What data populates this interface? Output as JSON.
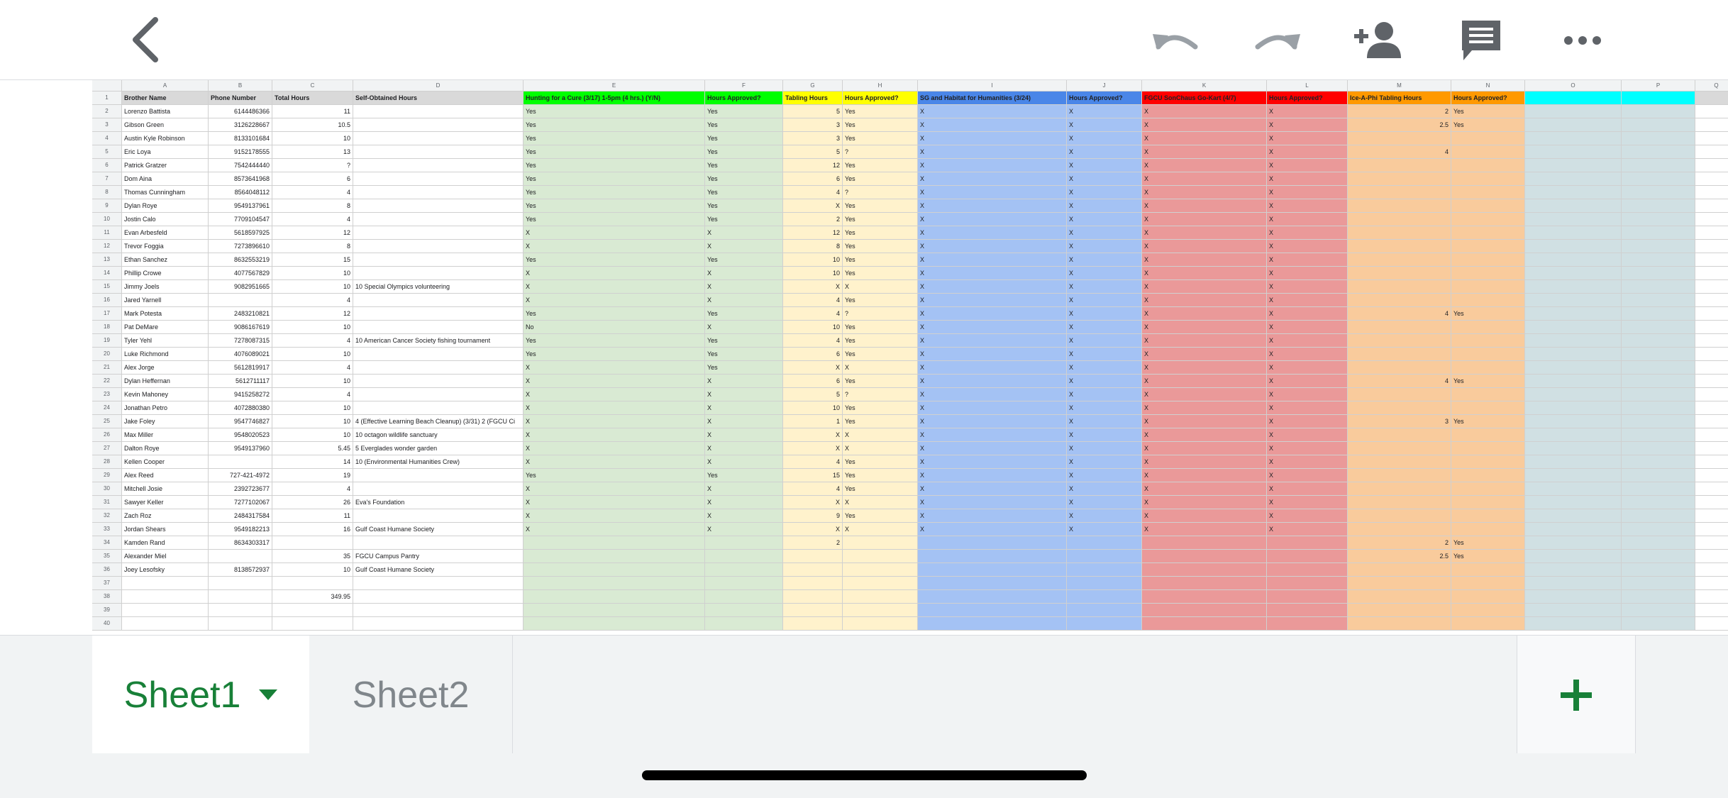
{
  "toolbar": {
    "back_icon": "back-chevron-icon",
    "undo_icon": "undo-icon",
    "redo_icon": "redo-icon",
    "share_icon": "add-person-icon",
    "comment_icon": "comment-icon",
    "more_icon": "more-horizontal-icon"
  },
  "sheet": {
    "columns": [
      "A",
      "B",
      "C",
      "D",
      "E",
      "F",
      "G",
      "H",
      "I",
      "J",
      "K",
      "L",
      "M",
      "N",
      "O",
      "P",
      "Q"
    ],
    "column_colors": {
      "E": "#d9ead3",
      "F": "#d9ead3",
      "G": "#fff2cc",
      "H": "#fff2cc",
      "I": "#a4c2f4",
      "J": "#a4c2f4",
      "K": "#ea9999",
      "L": "#ea9999",
      "M": "#f9cb9c",
      "N": "#f9cb9c",
      "O": "#d0e0e3",
      "P": "#d0e0e3"
    },
    "header_colors": {
      "E": "#00ff00",
      "F": "#00ff00",
      "G": "#ffff00",
      "H": "#ffff00",
      "I": "#4a86e8",
      "J": "#4a86e8",
      "K": "#ff0000",
      "L": "#ff0000",
      "M": "#ff9900",
      "N": "#ff9900",
      "O": "#00ffff",
      "P": "#00ffff"
    },
    "headers": [
      "Brother Name",
      "Phone Number",
      "Total Hours",
      "Self-Obtained Hours",
      "Hunting for a Cure (3/17) 1-5pm (4 hrs.) (Y/N)",
      "Hours Approved?",
      "Tabling Hours",
      "Hours Approved?",
      "SG and Habitat for Humanities (3/24)",
      "Hours Approved?",
      "FGCU SonChaus Go-Kart (4/7)",
      "Hours Approved?",
      "Ice-A-Phi Tabling Hours",
      "Hours Approved?",
      "",
      "",
      ""
    ],
    "rows": [
      [
        "Lorenzo Battista",
        "6144486366",
        "11",
        "",
        "Yes",
        "Yes",
        "5",
        "Yes",
        "X",
        "X",
        "X",
        "X",
        "2",
        "Yes",
        "",
        "",
        ""
      ],
      [
        "Gibson Green",
        "3126228667",
        "10.5",
        "",
        "Yes",
        "Yes",
        "3",
        "Yes",
        "X",
        "X",
        "X",
        "X",
        "2.5",
        "Yes",
        "",
        "",
        ""
      ],
      [
        "Austin Kyle Robinson",
        "8133101684",
        "10",
        "",
        "Yes",
        "Yes",
        "3",
        "Yes",
        "X",
        "X",
        "X",
        "X",
        "",
        "",
        "",
        "",
        ""
      ],
      [
        "Eric Loya",
        "9152178555",
        "13",
        "",
        "Yes",
        "Yes",
        "5",
        "?",
        "X",
        "X",
        "X",
        "X",
        "4",
        "",
        "",
        "",
        ""
      ],
      [
        "Patrick Gratzer",
        "7542444440",
        "?",
        "",
        "Yes",
        "Yes",
        "12",
        "Yes",
        "X",
        "X",
        "X",
        "X",
        "",
        "",
        "",
        "",
        ""
      ],
      [
        "Dom Aina",
        "8573641968",
        "6",
        "",
        "Yes",
        "Yes",
        "6",
        "Yes",
        "X",
        "X",
        "X",
        "X",
        "",
        "",
        "",
        "",
        ""
      ],
      [
        "Thomas Cunningham",
        "8564048112",
        "4",
        "",
        "Yes",
        "Yes",
        "4",
        "?",
        "X",
        "X",
        "X",
        "X",
        "",
        "",
        "",
        "",
        ""
      ],
      [
        "Dylan Roye",
        "9549137961",
        "8",
        "",
        "Yes",
        "Yes",
        "X",
        "Yes",
        "X",
        "X",
        "X",
        "X",
        "",
        "",
        "",
        "",
        ""
      ],
      [
        "Jostin Calo",
        "7709104547",
        "4",
        "",
        "Yes",
        "Yes",
        "2",
        "Yes",
        "X",
        "X",
        "X",
        "X",
        "",
        "",
        "",
        "",
        ""
      ],
      [
        "Evan Arbesfeld",
        "5618597925",
        "12",
        "",
        "X",
        "X",
        "12",
        "Yes",
        "X",
        "X",
        "X",
        "X",
        "",
        "",
        "",
        "",
        ""
      ],
      [
        "Trevor Foggia",
        "7273896610",
        "8",
        "",
        "X",
        "X",
        "8",
        "Yes",
        "X",
        "X",
        "X",
        "X",
        "",
        "",
        "",
        "",
        ""
      ],
      [
        "Ethan Sanchez",
        "8632553219",
        "15",
        "",
        "Yes",
        "Yes",
        "10",
        "Yes",
        "X",
        "X",
        "X",
        "X",
        "",
        "",
        "",
        "",
        ""
      ],
      [
        "Phillip Crowe",
        "4077567829",
        "10",
        "",
        "X",
        "X",
        "10",
        "Yes",
        "X",
        "X",
        "X",
        "X",
        "",
        "",
        "",
        "",
        ""
      ],
      [
        "Jimmy Joels",
        "9082951665",
        "10",
        "10 Special Olympics volunteering",
        "X",
        "X",
        "X",
        "X",
        "X",
        "X",
        "X",
        "X",
        "",
        "",
        "",
        "",
        ""
      ],
      [
        "Jared Yarnell",
        "",
        "4",
        "",
        "X",
        "X",
        "4",
        "Yes",
        "X",
        "X",
        "X",
        "X",
        "",
        "",
        "",
        "",
        ""
      ],
      [
        "Mark Potesta",
        "2483210821",
        "12",
        "",
        "Yes",
        "Yes",
        "4",
        "?",
        "X",
        "X",
        "X",
        "X",
        "4",
        "Yes",
        "",
        "",
        ""
      ],
      [
        "Pat DeMare",
        "9086167619",
        "10",
        "",
        "No",
        "X",
        "10",
        "Yes",
        "X",
        "X",
        "X",
        "X",
        "",
        "",
        "",
        "",
        ""
      ],
      [
        "Tyler Yehl",
        "7278087315",
        "4",
        "10 American Cancer Society fishing tournament",
        "Yes",
        "Yes",
        "4",
        "Yes",
        "X",
        "X",
        "X",
        "X",
        "",
        "",
        "",
        "",
        ""
      ],
      [
        "Luke Richmond",
        "4076089021",
        "10",
        "",
        "Yes",
        "Yes",
        "6",
        "Yes",
        "X",
        "X",
        "X",
        "X",
        "",
        "",
        "",
        "",
        ""
      ],
      [
        "Alex Jorge",
        "5612819917",
        "4",
        "",
        "X",
        "Yes",
        "X",
        "X",
        "X",
        "X",
        "X",
        "X",
        "",
        "",
        "",
        "",
        ""
      ],
      [
        "Dylan Heffernan",
        "5612711117",
        "10",
        "",
        "X",
        "X",
        "6",
        "Yes",
        "X",
        "X",
        "X",
        "X",
        "4",
        "Yes",
        "",
        "",
        ""
      ],
      [
        "Kevin Mahoney",
        "9415258272",
        "4",
        "",
        "X",
        "X",
        "5",
        "?",
        "X",
        "X",
        "X",
        "X",
        "",
        "",
        "",
        "",
        ""
      ],
      [
        "Jonathan Petro",
        "4072880380",
        "10",
        "",
        "X",
        "X",
        "10",
        "Yes",
        "X",
        "X",
        "X",
        "X",
        "",
        "",
        "",
        "",
        ""
      ],
      [
        "Jake Foley",
        "9547746827",
        "10",
        "4 (Effective Learning Beach Cleanup) (3/31)     2 (FGCU Ci",
        "X",
        "X",
        "1",
        "Yes",
        "X",
        "X",
        "X",
        "X",
        "3",
        "Yes",
        "",
        "",
        ""
      ],
      [
        "Max Miller",
        "9548020523",
        "10",
        "10 octagon wildlife sanctuary",
        "X",
        "X",
        "X",
        "X",
        "X",
        "X",
        "X",
        "X",
        "",
        "",
        "",
        "",
        ""
      ],
      [
        "Dalton Roye",
        "9549137960",
        "5.45",
        "5 Everglades wonder garden",
        "X",
        "X",
        "X",
        "X",
        "X",
        "X",
        "X",
        "X",
        "",
        "",
        "",
        "",
        ""
      ],
      [
        "Kellen Cooper",
        "",
        "14",
        "10 (Environmental Humanities Crew)",
        "X",
        "X",
        "4",
        "Yes",
        "X",
        "X",
        "X",
        "X",
        "",
        "",
        "",
        "",
        ""
      ],
      [
        "Alex Reed",
        "727-421-4972",
        "19",
        "",
        "Yes",
        "Yes",
        "15",
        "Yes",
        "X",
        "X",
        "X",
        "X",
        "",
        "",
        "",
        "",
        ""
      ],
      [
        "Mitchell Josie",
        "2392723677",
        "4",
        "",
        "X",
        "X",
        "4",
        "Yes",
        "X",
        "X",
        "X",
        "X",
        "",
        "",
        "",
        "",
        ""
      ],
      [
        "Sawyer Keller",
        "7277102067",
        "26",
        "Eva's Foundation",
        "X",
        "X",
        "X",
        "X",
        "X",
        "X",
        "X",
        "X",
        "",
        "",
        "",
        "",
        ""
      ],
      [
        "Zach Roz",
        "2484317584",
        "11",
        "",
        "X",
        "X",
        "9",
        "Yes",
        "X",
        "X",
        "X",
        "X",
        "",
        "",
        "",
        "",
        ""
      ],
      [
        "Jordan Shears",
        "9549182213",
        "16",
        "Gulf Coast Humane Society",
        "X",
        "X",
        "X",
        "X",
        "X",
        "X",
        "X",
        "X",
        "",
        "",
        "",
        "",
        ""
      ],
      [
        "Kamden Rand",
        "8634303317",
        "",
        "",
        "",
        "",
        "2",
        "",
        "",
        "",
        "",
        "",
        "2",
        "Yes",
        "",
        "",
        ""
      ],
      [
        "Alexander Miel",
        "",
        "35",
        "FGCU Campus Pantry",
        "",
        "",
        "",
        "",
        "",
        "",
        "",
        "",
        "2.5",
        "Yes",
        "",
        "",
        ""
      ],
      [
        "Joey Lesofsky",
        "8138572937",
        "10",
        "Gulf Coast Humane Society",
        "",
        "",
        "",
        "",
        "",
        "",
        "",
        "",
        "",
        "",
        "",
        "",
        ""
      ],
      [
        "",
        "",
        "",
        "",
        "",
        "",
        "",
        "",
        "",
        "",
        "",
        "",
        "",
        "",
        "",
        "",
        ""
      ],
      [
        "",
        "",
        "349.95",
        "",
        "",
        "",
        "",
        "",
        "",
        "",
        "",
        "",
        "",
        "",
        "",
        "",
        ""
      ],
      [
        "",
        "",
        "",
        "",
        "",
        "",
        "",
        "",
        "",
        "",
        "",
        "",
        "",
        "",
        "",
        "",
        ""
      ],
      [
        "",
        "",
        "",
        "",
        "",
        "",
        "",
        "",
        "",
        "",
        "",
        "",
        "",
        "",
        "",
        "",
        ""
      ]
    ]
  },
  "tabs": {
    "sheet1": "Sheet1",
    "sheet2": "Sheet2",
    "dropdown_icon": "caret-down-icon",
    "add_icon": "plus-icon"
  }
}
